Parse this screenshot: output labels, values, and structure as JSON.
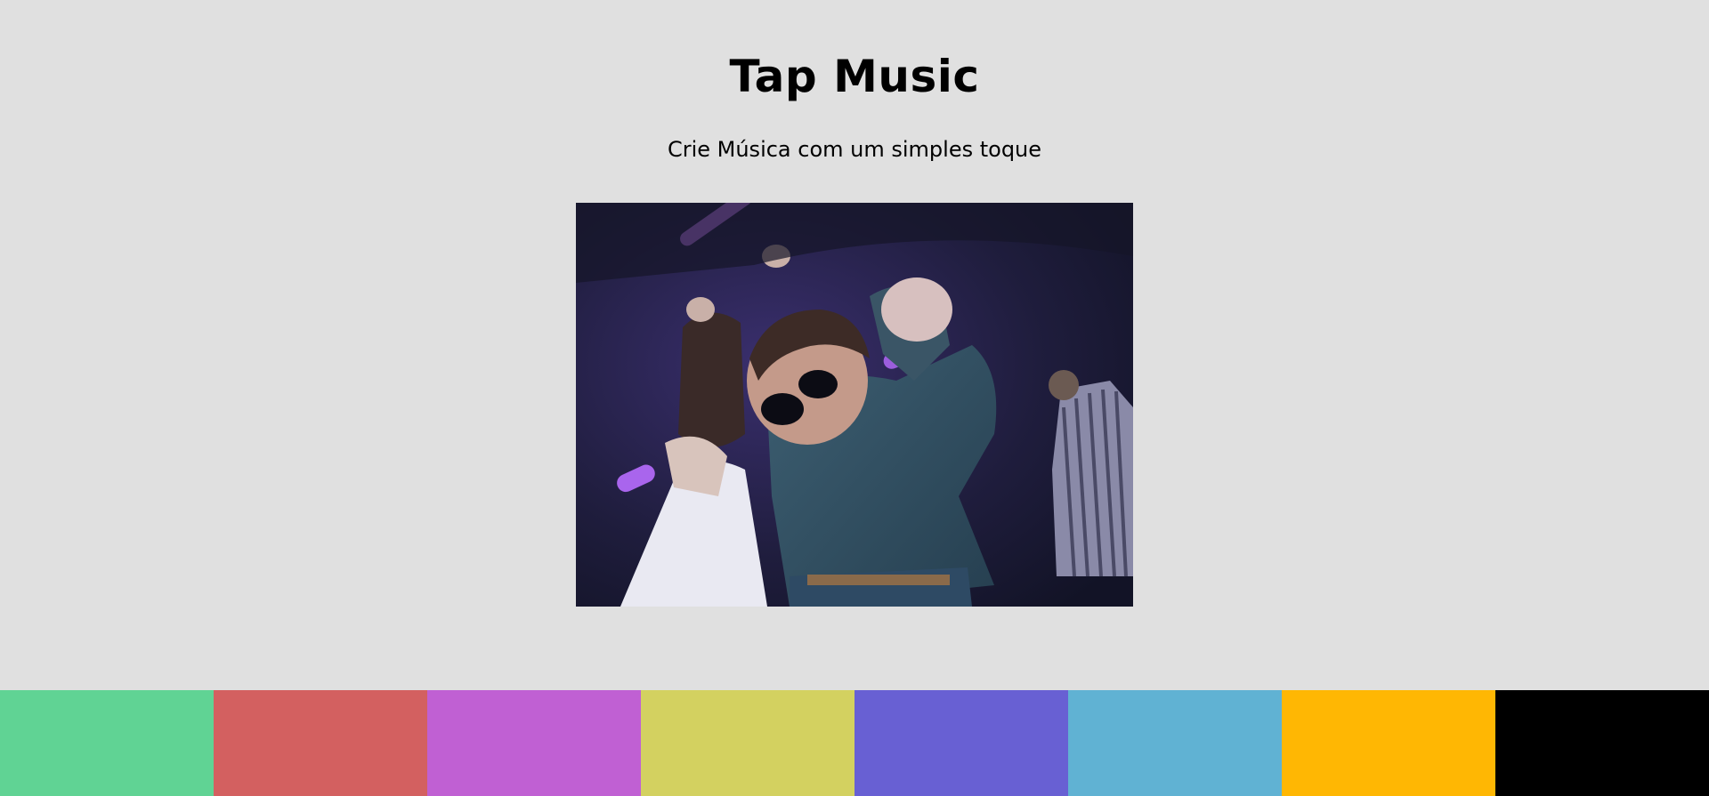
{
  "header": {
    "title": "Tap Music",
    "subtitle": "Crie Música com um simples toque"
  },
  "image": {
    "description_icon": "dancing-gif-image"
  },
  "pads": [
    {
      "name": "pad-1",
      "color": "#60d394"
    },
    {
      "name": "pad-2",
      "color": "#d36060"
    },
    {
      "name": "pad-3",
      "color": "#c060d3"
    },
    {
      "name": "pad-4",
      "color": "#d3d160"
    },
    {
      "name": "pad-5",
      "color": "#6860d3"
    },
    {
      "name": "pad-6",
      "color": "#60b2d3"
    },
    {
      "name": "pad-7",
      "color": "#ffb703"
    },
    {
      "name": "pad-8",
      "color": "#000000"
    }
  ]
}
